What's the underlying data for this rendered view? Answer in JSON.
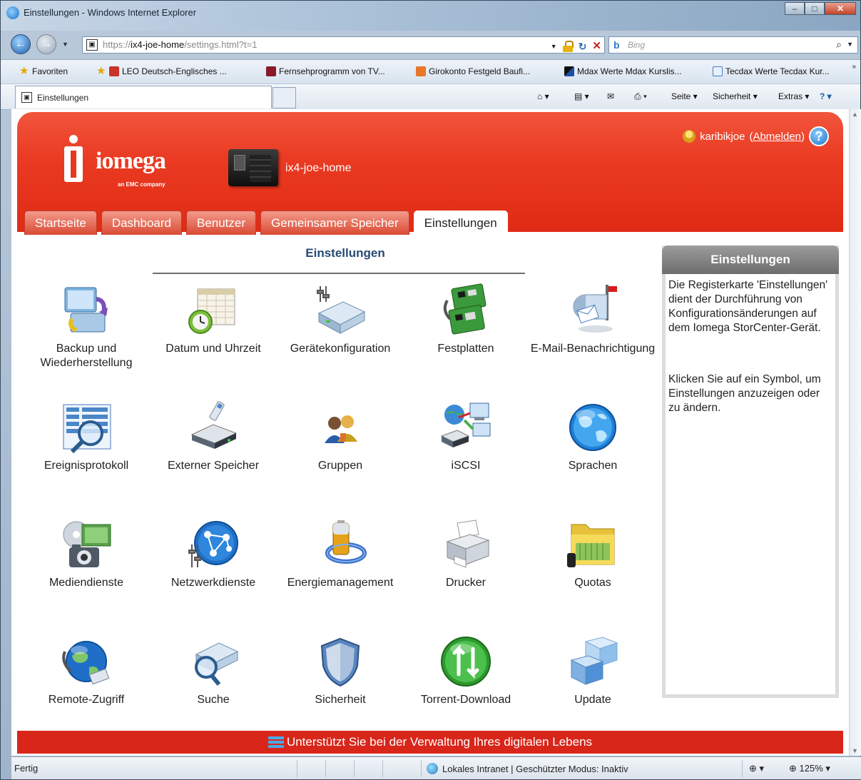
{
  "window": {
    "title": "Einstellungen - Windows Internet Explorer"
  },
  "address": {
    "prefix": "https://",
    "host": "ix4-joe-home",
    "path": "/settings.html?t=1"
  },
  "search": {
    "engine": "b",
    "placeholder": "Bing"
  },
  "favorites": [
    "Favoriten",
    "LEO Deutsch-Englisches ...",
    "Fernsehprogramm von TV...",
    "Girokonto  Festgeld  Baufi...",
    "Mdax Werte  Mdax Kurslis...",
    "Tecdax Werte  Tecdax Kur..."
  ],
  "browser_tab": {
    "label": "Einstellungen"
  },
  "commands": {
    "page": "Seite ▾",
    "security": "Sicherheit ▾",
    "extras": "Extras ▾"
  },
  "header": {
    "brand": "iomega",
    "brand_sub": "an EMC company",
    "device_name": "ix4-joe-home",
    "user": "karibikjoe",
    "logout": "Abmelden"
  },
  "tabs": [
    "Startseite",
    "Dashboard",
    "Benutzer",
    "Gemeinsamer Speicher",
    "Einstellungen"
  ],
  "active_tab": "Einstellungen",
  "main": {
    "title": "Einstellungen"
  },
  "tiles": [
    {
      "id": "backup",
      "label": "Backup und Wiederherstellung",
      "icon": "backup-icon"
    },
    {
      "id": "datetime",
      "label": "Datum und Uhrzeit",
      "icon": "calendar-clock-icon"
    },
    {
      "id": "device",
      "label": "Gerätekonfiguration",
      "icon": "device-config-icon"
    },
    {
      "id": "disks",
      "label": "Festplatten",
      "icon": "disk-board-icon"
    },
    {
      "id": "email",
      "label": "E-Mail-Benachrichtigung",
      "icon": "mailbox-icon"
    },
    {
      "id": "log",
      "label": "Ereignisprotokoll",
      "icon": "log-magnifier-icon"
    },
    {
      "id": "external",
      "label": "Externer Speicher",
      "icon": "external-drive-icon"
    },
    {
      "id": "groups",
      "label": "Gruppen",
      "icon": "users-group-icon"
    },
    {
      "id": "iscsi",
      "label": "iSCSI",
      "icon": "iscsi-network-icon"
    },
    {
      "id": "lang",
      "label": "Sprachen",
      "icon": "globe-icon"
    },
    {
      "id": "media",
      "label": "Mediendienste",
      "icon": "media-icon"
    },
    {
      "id": "network",
      "label": "Netzwerkdienste",
      "icon": "network-icon"
    },
    {
      "id": "power",
      "label": "Energiemanagement",
      "icon": "battery-icon"
    },
    {
      "id": "printer",
      "label": "Drucker",
      "icon": "printer-icon"
    },
    {
      "id": "quotas",
      "label": "Quotas",
      "icon": "folder-quota-icon"
    },
    {
      "id": "remote",
      "label": "Remote-Zugriff",
      "icon": "remote-globe-icon"
    },
    {
      "id": "search",
      "label": "Suche",
      "icon": "search-drive-icon"
    },
    {
      "id": "security",
      "label": "Sicherheit",
      "icon": "shield-icon"
    },
    {
      "id": "torrent",
      "label": "Torrent-Download",
      "icon": "torrent-icon"
    },
    {
      "id": "update",
      "label": "Update",
      "icon": "update-box-icon"
    }
  ],
  "side": {
    "title": "Einstellungen",
    "text1": "Die Registerkarte 'Einstellungen' dient der Durchführung von Konfigurationsänderungen auf dem Iomega StorCenter-Gerät.",
    "text2": "Klicken Sie auf ein Symbol, um Einstellungen anzuzeigen oder zu ändern."
  },
  "footer": {
    "slogan": "Unterstützt Sie bei der Verwaltung Ihres digitalen Lebens"
  },
  "status": {
    "left": "Fertig",
    "zone": "Lokales Intranet | Geschützter Modus: Inaktiv",
    "zoom": "125%"
  },
  "colors": {
    "brand_red": "#e8391f",
    "tab_active_bg": "#ffffff",
    "title_blue": "#264a72"
  }
}
